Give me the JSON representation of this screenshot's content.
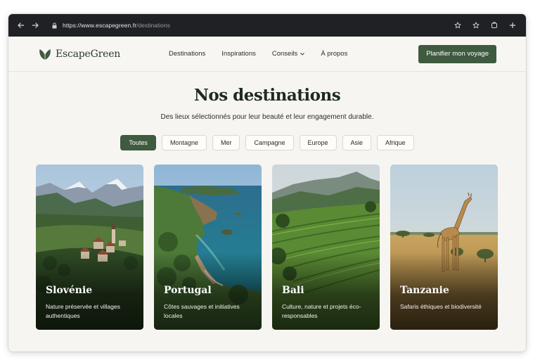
{
  "browser": {
    "url_host": "https://www.escapegreen.fr",
    "url_path": "/destinations"
  },
  "site": {
    "logo_text": "EscapeGreen",
    "nav": [
      {
        "label": "Destinations"
      },
      {
        "label": "Inspirations"
      },
      {
        "label": "Conseils"
      },
      {
        "label": "À propos"
      }
    ],
    "cta_label": "Planifier mon voyage",
    "brand_color": "#3e5a3f"
  },
  "hero": {
    "title": "Nos destinations",
    "subtitle": "Des lieux sélectionnés pour leur beauté et leur engagement durable."
  },
  "filters": [
    {
      "label": "Toutes",
      "active": true
    },
    {
      "label": "Montagne"
    },
    {
      "label": "Mer"
    },
    {
      "label": "Campagne"
    },
    {
      "label": "Europe"
    },
    {
      "label": "Asie"
    },
    {
      "label": "Afrique"
    }
  ],
  "destinations": [
    {
      "name": "Slovénie",
      "description": "Nature préservée et villages authentiques"
    },
    {
      "name": "Portugal",
      "description": "Côtes sauvages et initiatives locales"
    },
    {
      "name": "Bali",
      "description": "Culture, nature et projets éco-responsables"
    },
    {
      "name": "Tanzanie",
      "description": "Safaris éthiques et biodiversité"
    }
  ]
}
